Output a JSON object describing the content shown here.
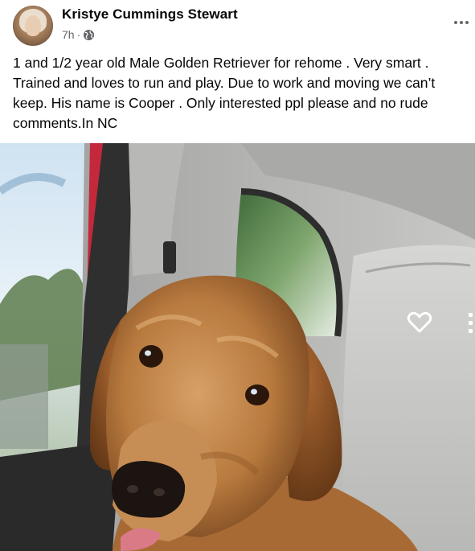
{
  "post": {
    "author": "Kristye Cummings Stewart",
    "time": "7h",
    "separator": "·",
    "privacy_icon": "globe-icon",
    "more_icon": "more-options-icon",
    "text": "1 and 1/2 year old Male Golden Retriever for rehome . Very smart .\nTrained and loves to run and play. Due to work and moving we can’t\nkeep. His name is Cooper . Only interested ppl please and no rude\ncomments.In NC"
  },
  "photo": {
    "subject": "golden-retriever-photo",
    "like_icon": "heart-outline-icon",
    "more_icon": "more-vertical-icon"
  },
  "colors": {
    "text": "#050505",
    "secondary_text": "#65676b",
    "background": "#ffffff"
  }
}
